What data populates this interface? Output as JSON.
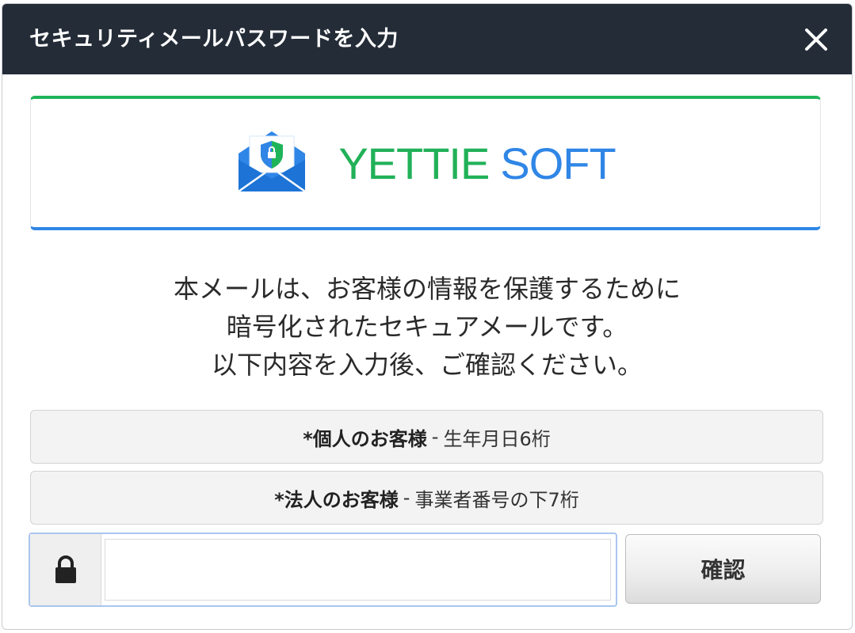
{
  "window": {
    "title": "セキュリティメールパスワードを入力",
    "close_icon": "close-icon"
  },
  "logo": {
    "icon": "shield-envelope-icon",
    "brand_part1": "YETTIE",
    "brand_part2": "SOFT",
    "colors": {
      "green": "#21b158",
      "blue": "#2f86e6"
    }
  },
  "message": {
    "line1": "本メールは、お客様の情報を保護するために",
    "line2": "暗号化されたセキュアメールです。",
    "line3": "以下内容を入力後、ご確認ください。"
  },
  "notes": [
    {
      "label": "*個人のお客様",
      "dash": "-",
      "detail": "生年月日6桁"
    },
    {
      "label": "*法人のお客様",
      "dash": "-",
      "detail": "事業者番号の下7桁"
    }
  ],
  "password": {
    "icon": "lock-icon",
    "value": "",
    "placeholder": ""
  },
  "confirm_button": {
    "label": "確認"
  }
}
